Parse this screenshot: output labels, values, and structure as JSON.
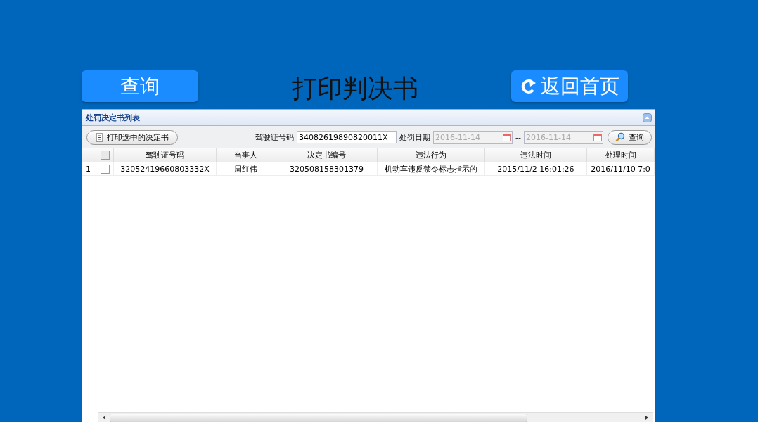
{
  "header": {
    "query_button": "查询",
    "title": "打印判决书",
    "back_button": "返回首页"
  },
  "panel": {
    "title": "处罚决定书列表",
    "print_button": "打印选中的决定书",
    "filters": {
      "license_label": "驾驶证号码",
      "license_value": "34082619890820011X",
      "date_label": "处罚日期",
      "date_from": {
        "value": "2016-11-14",
        "disabled": true
      },
      "separator": "--",
      "date_to": {
        "value": "2016-11-14",
        "disabled": true
      },
      "search_button": "查询"
    },
    "table": {
      "header_checked": false,
      "columns": [
        "驾驶证号码",
        "当事人",
        "决定书编号",
        "违法行为",
        "违法时间",
        "处理时间"
      ],
      "rows": [
        {
          "index": "1",
          "checked": false,
          "cells": [
            "32052419660803332X",
            "周红伟",
            "320508158301379",
            "机动车违反禁令标志指示的",
            "2015/11/2 16:01:26",
            "2016/11/10 7:0"
          ]
        }
      ]
    }
  }
}
